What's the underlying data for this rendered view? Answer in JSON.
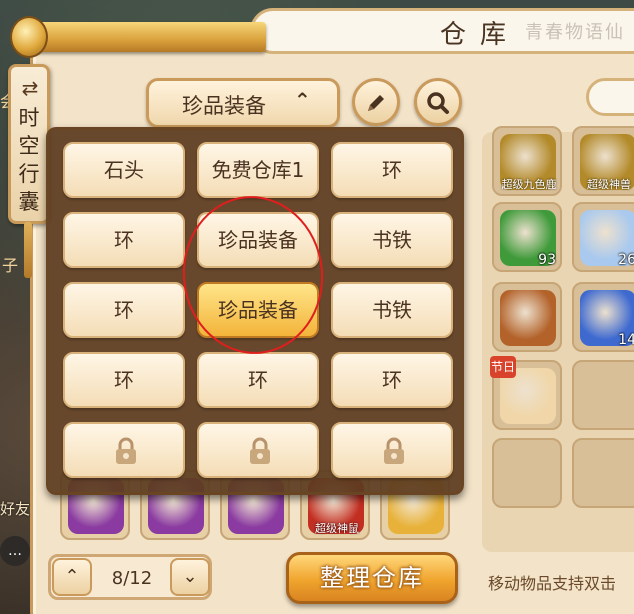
{
  "window": {
    "title": "仓库",
    "title_deco": "青春物语仙"
  },
  "side_tab": {
    "swap_icon": "⇄",
    "label": "时空行囊"
  },
  "selector": {
    "label": "珍品装备",
    "chevron": "⌃"
  },
  "toolbar": {
    "rename_icon": "pencil-icon",
    "search_icon": "search-icon"
  },
  "dropdown": {
    "options": [
      {
        "label": "石头",
        "state": "normal"
      },
      {
        "label": "免费仓库1",
        "state": "normal"
      },
      {
        "label": "环",
        "state": "normal"
      },
      {
        "label": "环",
        "state": "normal"
      },
      {
        "label": "珍品装备",
        "state": "normal"
      },
      {
        "label": "书铁",
        "state": "normal"
      },
      {
        "label": "环",
        "state": "normal"
      },
      {
        "label": "珍品装备",
        "state": "selected"
      },
      {
        "label": "书铁",
        "state": "normal"
      },
      {
        "label": "环",
        "state": "normal"
      },
      {
        "label": "环",
        "state": "normal"
      },
      {
        "label": "环",
        "state": "normal"
      },
      {
        "label": "",
        "state": "locked"
      },
      {
        "label": "",
        "state": "locked"
      },
      {
        "label": "",
        "state": "locked"
      }
    ]
  },
  "bag_items": [
    {
      "name": "超级九色鹿",
      "count": "",
      "tag": "",
      "color": "#b38a2a"
    },
    {
      "name": "超级神兽",
      "count": "",
      "tag": "",
      "color": "#b38a2a"
    },
    {
      "name": "",
      "count": "93",
      "tag": "",
      "color": "#3f9a3a"
    },
    {
      "name": "",
      "count": "26",
      "tag": "",
      "color": "#a9c9ee"
    },
    {
      "name": "",
      "count": "",
      "tag": "",
      "color": "#b3622a"
    },
    {
      "name": "",
      "count": "14",
      "tag": "",
      "color": "#3e6ad0"
    },
    {
      "name": "",
      "count": "",
      "tag": "节日",
      "color": "#f0d6a8"
    }
  ],
  "warehouse_items": [
    {
      "name": "",
      "color": "#8a3aa0"
    },
    {
      "name": "",
      "color": "#8a3aa0"
    },
    {
      "name": "",
      "color": "#8a3aa0"
    },
    {
      "name": "超级神鼠",
      "color": "#c22e22"
    },
    {
      "name": "",
      "color": "#e8b23a"
    }
  ],
  "pager": {
    "text": "8/12",
    "up_icon": "⌃",
    "down_icon": "⌄"
  },
  "organize_button": "整理仓库",
  "hint": "移动物品支持双击",
  "edge": {
    "friend_text": "好友",
    "zi_text": "子",
    "hui_text": "会"
  }
}
